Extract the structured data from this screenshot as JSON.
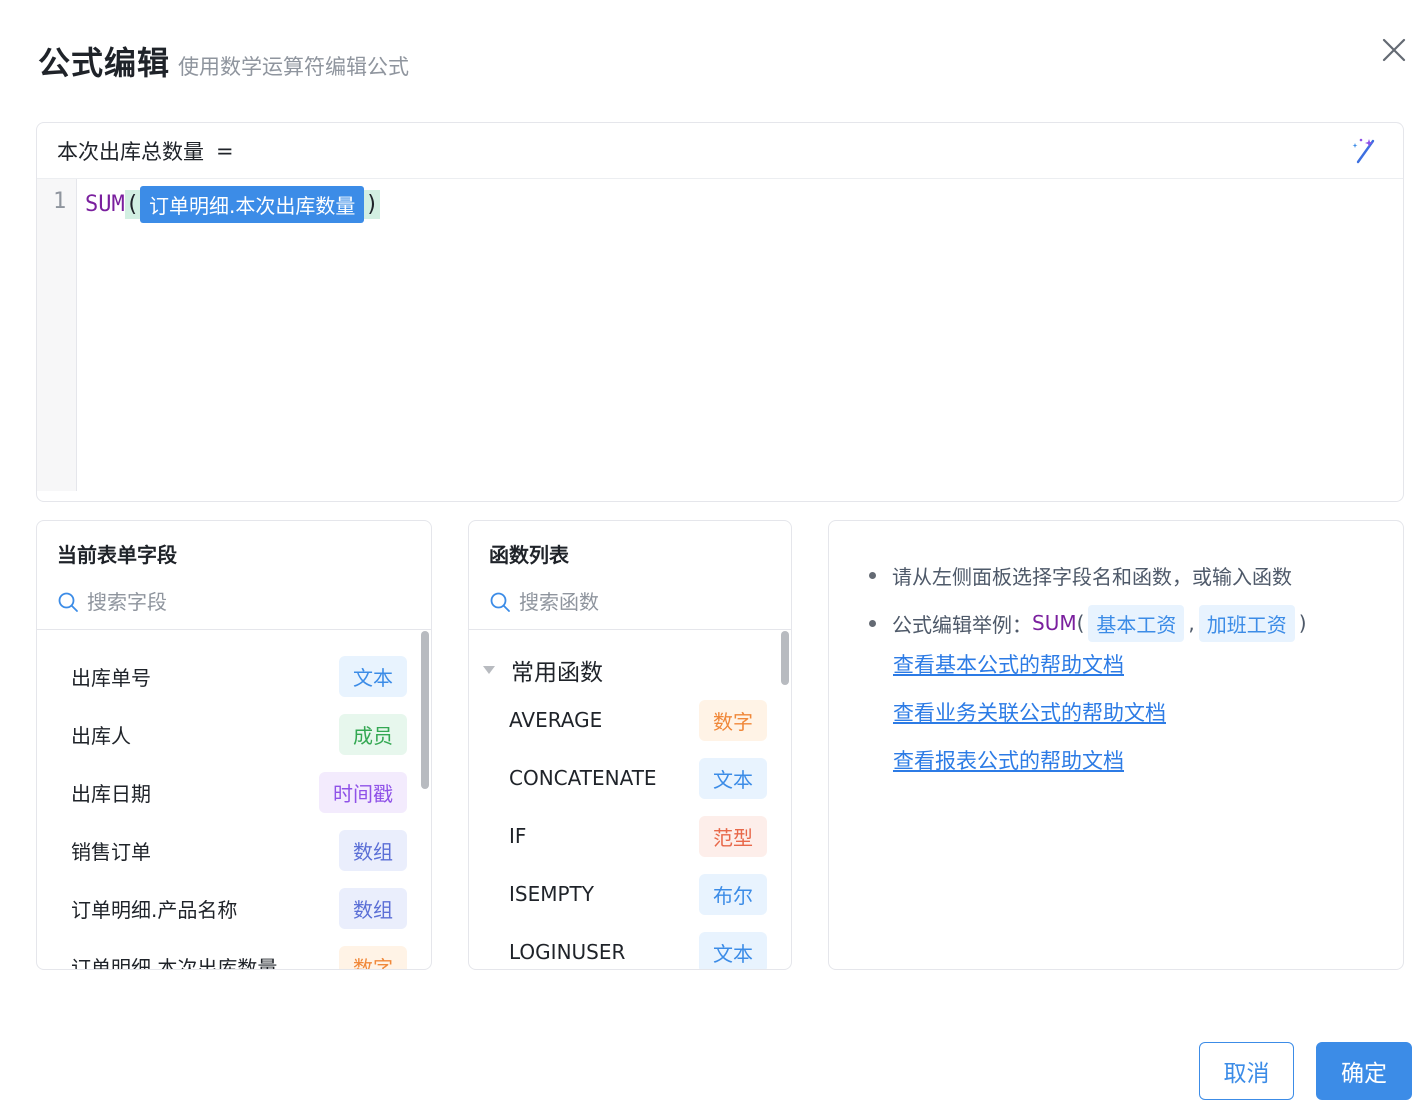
{
  "dialog": {
    "title": "公式编辑",
    "subtitle": "使用数学运算符编辑公式"
  },
  "editor": {
    "target_label": "本次出库总数量",
    "equals": "=",
    "line_number": "1",
    "formula_fn": "SUM",
    "open_paren": "(",
    "field_token": "订单明细.本次出库数量",
    "close_paren": ")"
  },
  "fields_panel": {
    "title": "当前表单字段",
    "search_placeholder": "搜索字段",
    "items": [
      {
        "label": "出库单号",
        "type": "文本"
      },
      {
        "label": "出库人",
        "type": "成员"
      },
      {
        "label": "出库日期",
        "type": "时间戳"
      },
      {
        "label": "销售订单",
        "type": "数组"
      },
      {
        "label": "订单明细.产品名称",
        "type": "数组"
      },
      {
        "label": "订单明细.本次出库数量",
        "type": "数字"
      }
    ]
  },
  "functions_panel": {
    "title": "函数列表",
    "search_placeholder": "搜索函数",
    "group": "常用函数",
    "items": [
      {
        "label": "AVERAGE",
        "type": "数字"
      },
      {
        "label": "CONCATENATE",
        "type": "文本"
      },
      {
        "label": "IF",
        "type": "范型"
      },
      {
        "label": "ISEMPTY",
        "type": "布尔"
      },
      {
        "label": "LOGINUSER",
        "type": "文本"
      }
    ]
  },
  "help_panel": {
    "tip1": "请从左侧面板选择字段名和函数，或输入函数",
    "tip2_prefix": "公式编辑举例：",
    "example_fn": "SUM",
    "example_open": "(",
    "example_field1": "基本工资",
    "example_sep": ",",
    "example_field2": "加班工资",
    "example_close": ")",
    "links": [
      "查看基本公式的帮助文档",
      "查看业务关联公式的帮助文档",
      "查看报表公式的帮助文档"
    ]
  },
  "footer": {
    "cancel_label": "取消",
    "ok_label": "确定"
  },
  "colors": {
    "accent": "#3c8ce7",
    "function_purple": "#7a1f9e"
  },
  "icons": [
    "close-icon",
    "magic-wand-icon",
    "search-icon",
    "caret-down-icon"
  ]
}
